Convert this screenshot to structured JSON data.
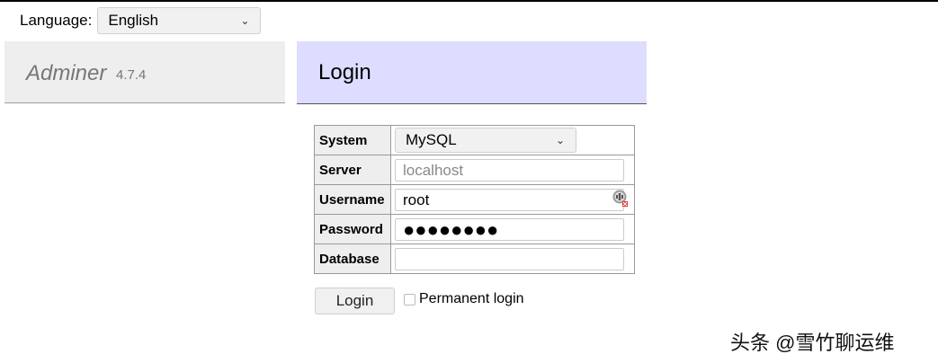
{
  "language": {
    "label": "Language:",
    "selected": "English"
  },
  "brand": {
    "name": "Adminer",
    "version": "4.7.4"
  },
  "content": {
    "title": "Login"
  },
  "form": {
    "system": {
      "label": "System",
      "value": "MySQL"
    },
    "server": {
      "label": "Server",
      "placeholder": "localhost"
    },
    "username": {
      "label": "Username",
      "value": "root"
    },
    "password": {
      "label": "Password",
      "value": "●●●●●●●●"
    },
    "database": {
      "label": "Database",
      "value": ""
    }
  },
  "actions": {
    "login_label": "Login",
    "permanent_label": "Permanent login",
    "permanent_checked": false
  },
  "watermark": "头条 @雪竹聊运维",
  "icons": {
    "dropdown": "chevron-down-icon",
    "autofill": "key-autofill-icon"
  },
  "colors": {
    "header_bg": "#ddddff",
    "brand_bg": "#eeeeee"
  }
}
